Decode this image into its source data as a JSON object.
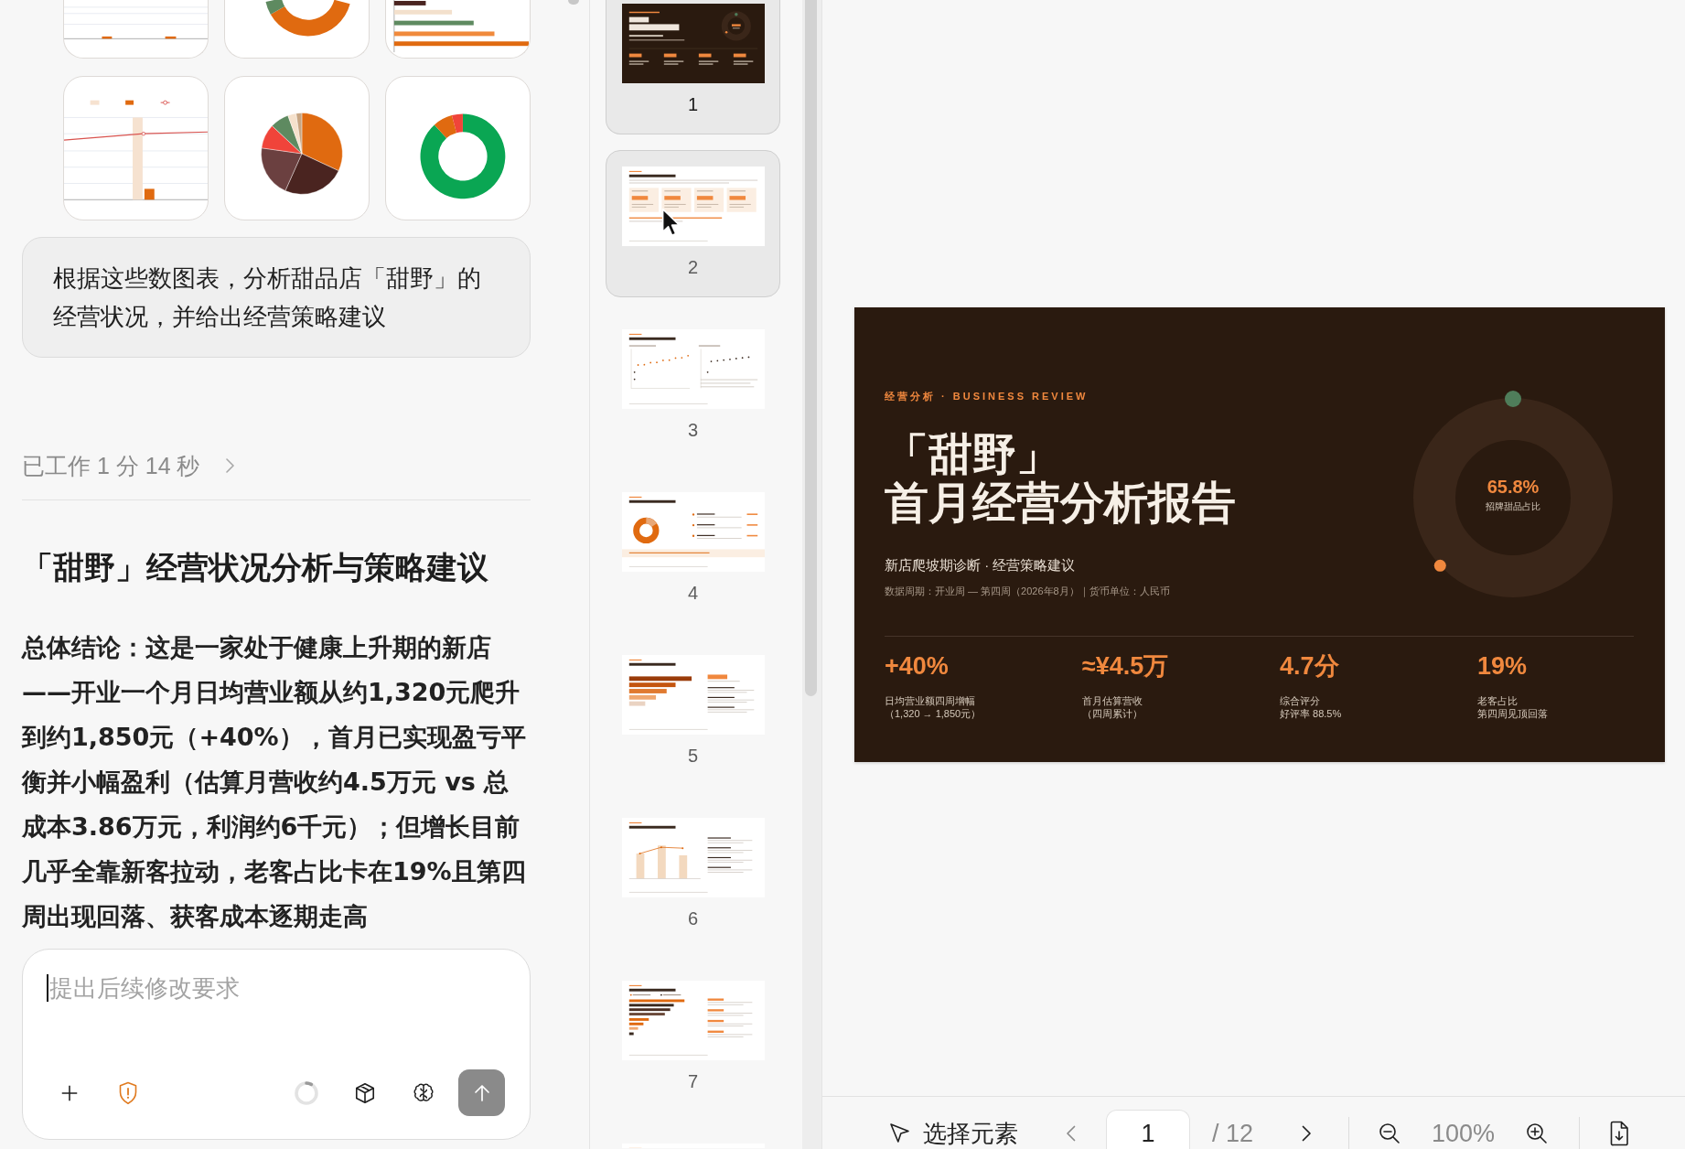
{
  "chat": {
    "attachments": [
      {
        "kind": "columns"
      },
      {
        "kind": "donut"
      },
      {
        "kind": "hbars"
      },
      {
        "kind": "combo"
      },
      {
        "kind": "pie"
      },
      {
        "kind": "rating"
      }
    ],
    "user_message": "根据这些数图表，分析甜品店「甜野」的经营状况，并给出经营策略建议",
    "work_status": {
      "label": "已工作 1 分 14 秒",
      "expanded": false
    },
    "answer": {
      "title": "「甜野」经营状况分析与策略建议",
      "paragraph": "总体结论：这是一家处于健康上升期的新店——开业一个月日均营业额从约1,320元爬升到约1,850元（+40%），首月已实现盈亏平衡并小幅盈利（估算月营收约4.5万元 vs 总成本3.86万元，利润约6千元）；但增长目前几乎全靠新客拉动，老客占比卡在19%且第四周出现回落、获客成本逐期走高"
    }
  },
  "composer": {
    "placeholder": "提出后续修改要求",
    "send_button": {
      "disabled": true
    }
  },
  "slide_panel": {
    "thumbnails": [
      {
        "kind": "cover",
        "number": "1",
        "selected": true,
        "hovered": false
      },
      {
        "kind": "kpi",
        "number": "2",
        "selected": false,
        "hovered": true
      },
      {
        "kind": "scatter",
        "number": "3",
        "selected": false,
        "hovered": false
      },
      {
        "kind": "donut",
        "number": "4",
        "selected": false,
        "hovered": false
      },
      {
        "kind": "bars",
        "number": "5",
        "selected": false,
        "hovered": false
      },
      {
        "kind": "columns",
        "number": "6",
        "selected": false,
        "hovered": false
      },
      {
        "kind": "hbars",
        "number": "7",
        "selected": false,
        "hovered": false
      },
      {
        "kind": "heading",
        "selected": false,
        "hovered": false
      }
    ]
  },
  "slide": {
    "kicker": "经营分析 · BUSINESS REVIEW",
    "title_lines": [
      "「甜野」",
      "首月经营分析报告"
    ],
    "subtitle": "新店爬坡期诊断 · 经营策略建议",
    "meta": "数据周期：开业周 — 第四周（2026年8月）｜货币单位：人民币",
    "gauge": {
      "value": "65.8%",
      "label": "招牌甜品占比"
    },
    "stats": [
      {
        "value": "+40%",
        "caption_lines": [
          "日均营业额四周增幅",
          "（1,320 → 1,850元）"
        ]
      },
      {
        "value": "≈¥4.5万",
        "caption_lines": [
          "首月估算营收",
          "（四周累计）"
        ]
      },
      {
        "value": "4.7分",
        "caption_lines": [
          "综合评分",
          "好评率 88.5%"
        ]
      },
      {
        "value": "19%",
        "caption_lines": [
          "老客占比",
          "第四周见顶回落"
        ]
      }
    ]
  },
  "toolbar": {
    "select_tool": "选择元素",
    "page": "1",
    "page_total": "/ 12",
    "zoom": "100%"
  }
}
